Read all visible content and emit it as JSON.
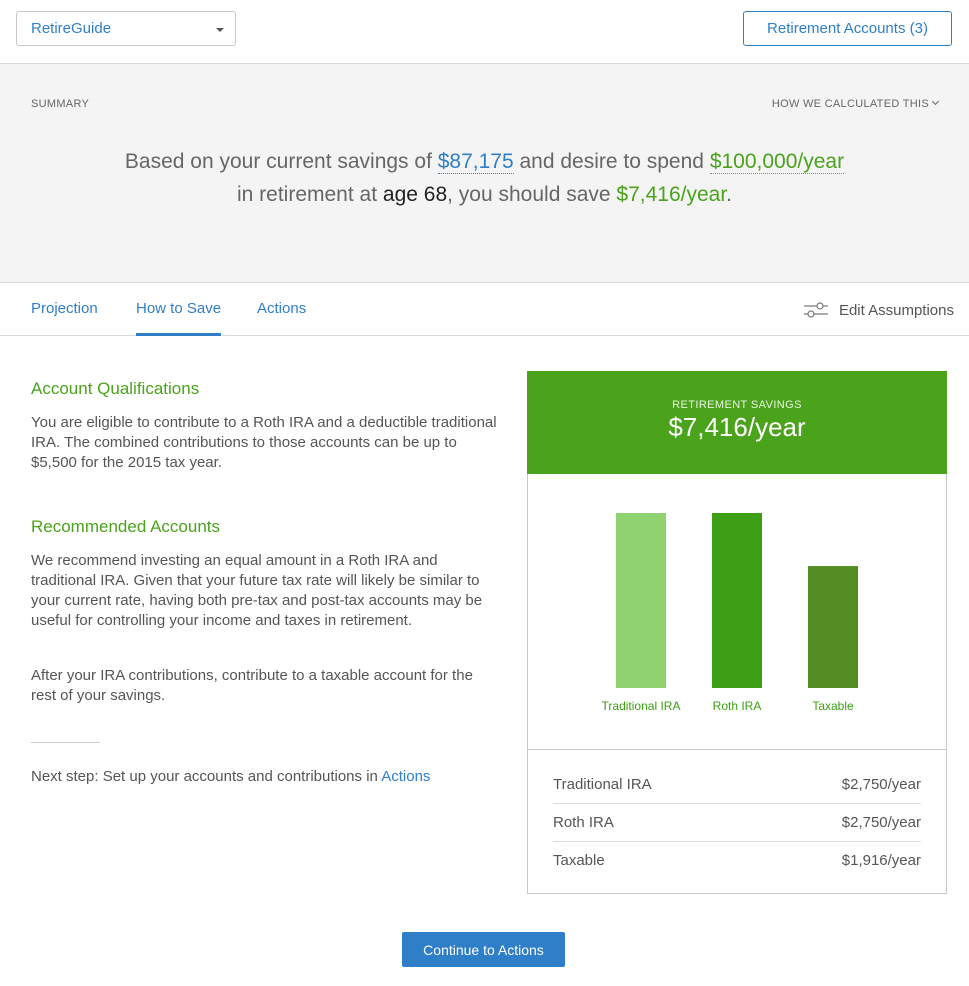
{
  "header": {
    "app_select_value": "RetireGuide",
    "accounts_button": "Retirement Accounts (3)"
  },
  "summary": {
    "label": "SUMMARY",
    "how_calculated": "HOW WE CALCULATED THIS",
    "part1": "Based on your current savings of ",
    "savings": "$87,175",
    "part2": " and desire to spend ",
    "spend": "$100,000/year",
    "part3": "in retirement at ",
    "age": "age 68",
    "part4": ", you should save ",
    "save": "$7,416/year",
    "part5": "."
  },
  "tabs": [
    {
      "label": "Projection"
    },
    {
      "label": "How to Save"
    },
    {
      "label": "Actions"
    }
  ],
  "edit_assumptions": "Edit Assumptions",
  "content": {
    "qual_heading": "Account Qualifications",
    "qual_text": "You are eligible to contribute to a Roth IRA and a deductible traditional IRA. The combined contributions to those accounts can be up to $5,500 for the 2015 tax year.",
    "rec_heading": "Recommended Accounts",
    "rec_text": "We recommend investing an equal amount in a Roth IRA and traditional IRA. Given that your future tax rate will likely be similar to your current rate, having both pre-tax and post-tax accounts may be useful for controlling your income and taxes in retirement.",
    "after_text": "After your IRA contributions, contribute to a taxable account for the rest of your savings.",
    "next_step_prefix": "Next step: Set up your accounts and contributions in ",
    "next_step_link": "Actions"
  },
  "card": {
    "title": "RETIREMENT SAVINGS",
    "amount": "$7,416/year",
    "rows": [
      {
        "name": "Traditional IRA",
        "value": "$2,750/year"
      },
      {
        "name": "Roth IRA",
        "value": "$2,750/year"
      },
      {
        "name": "Taxable",
        "value": "$1,916/year"
      }
    ]
  },
  "chart_data": {
    "type": "bar",
    "categories": [
      "Traditional IRA",
      "Roth IRA",
      "Taxable"
    ],
    "values": [
      2750,
      2750,
      1916
    ],
    "colors": [
      "#90d170",
      "#3c9f15",
      "#528c22"
    ],
    "ylim": [
      0,
      2750
    ],
    "title": "",
    "xlabel": "",
    "ylabel": ""
  },
  "continue_button": "Continue to Actions",
  "colors": {
    "accent_blue": "#2f7fc8",
    "accent_green": "#4aa31b"
  }
}
